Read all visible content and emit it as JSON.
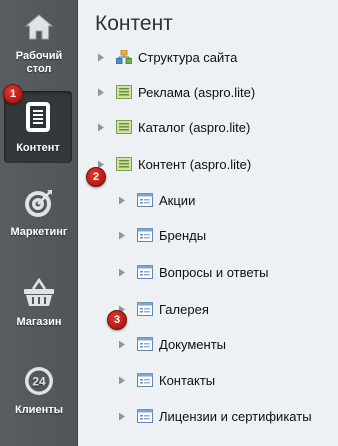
{
  "sidebar": {
    "items": [
      {
        "label": "Рабочий стол",
        "icon": "home-icon"
      },
      {
        "label": "Контент",
        "icon": "document-icon",
        "active": true
      },
      {
        "label": "Маркетинг",
        "icon": "target-icon"
      },
      {
        "label": "Магазин",
        "icon": "basket-icon"
      },
      {
        "label": "Клиенты",
        "icon": "clock-24-icon",
        "icon_text": "24"
      }
    ]
  },
  "badges": [
    "1",
    "2",
    "3"
  ],
  "main": {
    "title": "Контент",
    "tree": [
      {
        "label": "Структура сайта",
        "icon": "site-structure-icon",
        "level": 0
      },
      {
        "label": "Реклама (aspro.lite)",
        "icon": "folder-green-icon",
        "level": 0
      },
      {
        "label": "Каталог (aspro.lite)",
        "icon": "folder-green-icon",
        "level": 0
      },
      {
        "label": "Контент (aspro.lite)",
        "icon": "folder-green-icon",
        "level": 0
      },
      {
        "label": "Акции",
        "icon": "infoblock-icon",
        "level": 1
      },
      {
        "label": "Бренды",
        "icon": "infoblock-icon",
        "level": 1
      },
      {
        "label": "Вопросы и ответы",
        "icon": "infoblock-icon",
        "level": 1
      },
      {
        "label": "Галерея",
        "icon": "infoblock-icon",
        "level": 1
      },
      {
        "label": "Документы",
        "icon": "infoblock-icon",
        "level": 1
      },
      {
        "label": "Контакты",
        "icon": "infoblock-icon",
        "level": 1
      },
      {
        "label": "Лицензии и сертификаты",
        "icon": "infoblock-icon",
        "level": 1
      }
    ]
  },
  "colors": {
    "sidebar_bg": "#52585c",
    "active_bg": "#33383b",
    "badge_red": "#c0221a",
    "main_bg": "#eef1f3"
  }
}
